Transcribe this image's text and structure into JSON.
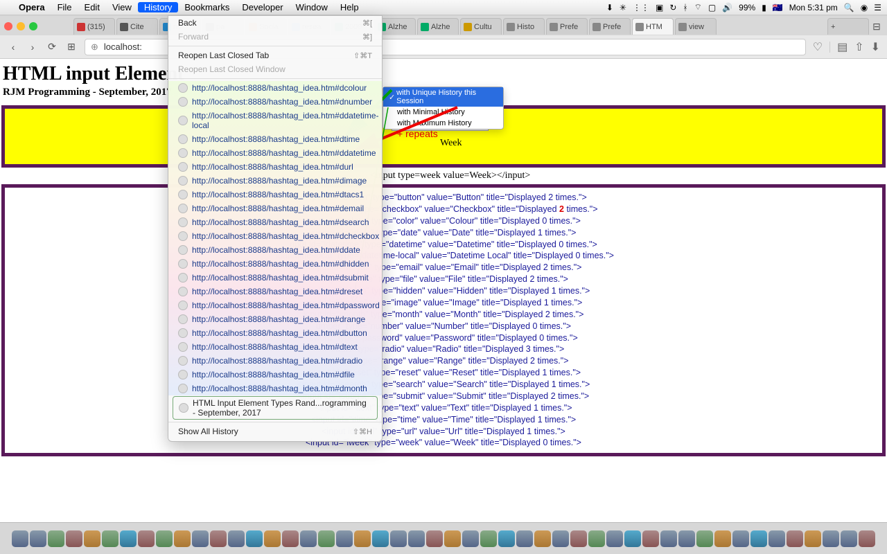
{
  "menubar": {
    "app": "Opera",
    "items": [
      "File",
      "Edit",
      "View",
      "History",
      "Bookmarks",
      "Developer",
      "Window",
      "Help"
    ],
    "open_index": 3,
    "tray": {
      "battery": "99%",
      "clock": "Mon 5:31 pm",
      "flag": "🇦🇺"
    }
  },
  "tabs": {
    "items": [
      {
        "label": "(315)",
        "icon": "#c33"
      },
      {
        "label": "Cite",
        "icon": "#555"
      },
      {
        "label": "ns",
        "icon": "#28c"
      },
      {
        "label": "pa",
        "icon": "#555"
      },
      {
        "label": "Socia",
        "icon": "#e60"
      },
      {
        "label": "resea",
        "icon": "#4285f4"
      },
      {
        "label": "2009",
        "icon": "#0a6"
      },
      {
        "label": "Alzhe",
        "icon": "#0a6"
      },
      {
        "label": "Alzhe",
        "icon": "#0a6"
      },
      {
        "label": "Cultu",
        "icon": "#c90"
      },
      {
        "label": "Histo",
        "icon": "#888"
      },
      {
        "label": "Prefe",
        "icon": "#888"
      },
      {
        "label": "Prefe",
        "icon": "#888"
      },
      {
        "label": "HTM",
        "icon": "#888",
        "active": true
      },
      {
        "label": "view",
        "icon": "#888"
      }
    ]
  },
  "address": "localhost:",
  "history_menu": {
    "back": "Back",
    "back_kb": "⌘[",
    "forward": "Forward",
    "forward_kb": "⌘]",
    "reopen": "Reopen Last Closed Tab",
    "reopen_kb": "⇧⌘T",
    "reopen_win": "Reopen Last Closed Window",
    "urls": [
      "http://localhost:8888/hashtag_idea.htm#dcolour",
      "http://localhost:8888/hashtag_idea.htm#dnumber",
      "http://localhost:8888/hashtag_idea.htm#ddatetime-local",
      "http://localhost:8888/hashtag_idea.htm#dtime",
      "http://localhost:8888/hashtag_idea.htm#ddatetime",
      "http://localhost:8888/hashtag_idea.htm#durl",
      "http://localhost:8888/hashtag_idea.htm#dimage",
      "http://localhost:8888/hashtag_idea.htm#dtacs1",
      "http://localhost:8888/hashtag_idea.htm#demail",
      "http://localhost:8888/hashtag_idea.htm#dsearch",
      "http://localhost:8888/hashtag_idea.htm#dcheckbox",
      "http://localhost:8888/hashtag_idea.htm#ddate",
      "http://localhost:8888/hashtag_idea.htm#dhidden",
      "http://localhost:8888/hashtag_idea.htm#dsubmit",
      "http://localhost:8888/hashtag_idea.htm#dreset",
      "http://localhost:8888/hashtag_idea.htm#dpassword",
      "http://localhost:8888/hashtag_idea.htm#drange",
      "http://localhost:8888/hashtag_idea.htm#dbutton",
      "http://localhost:8888/hashtag_idea.htm#dtext",
      "http://localhost:8888/hashtag_idea.htm#dradio",
      "http://localhost:8888/hashtag_idea.htm#dfile",
      "http://localhost:8888/hashtag_idea.htm#dmonth"
    ],
    "pagehist": "HTML Input Element Types Rand...rogramming - September, 2017",
    "showall": "Show All History",
    "showall_kb": "⇧⌘H"
  },
  "submenu": {
    "items": [
      "with Unique History this Session",
      "with Minimal History",
      "with Maximum History"
    ],
    "selected": 0
  },
  "page": {
    "h1": "HTML input Element",
    "h3": "RJM Programming - September, 2017",
    "week_placeholder": "Week --, ----",
    "week_label": "Week",
    "repeats": "+ repeats",
    "codeline": "<input type=week value=Week></input>",
    "codebox": [
      "<input id=\"ibutton\" type=\"button\" value=\"Button\" title=\"Displayed 2 times.\">",
      "ut id=\"icheckbox\" type=\"checkbox\" value=\"Checkbox\" title=\"Displayed 2 times.\">",
      "nput id=\"icolour\" type=\"color\" value=\"Colour\" title=\"Displayed 0 times.\">",
      "<input id=\"idate\" type=\"date\" value=\"Date\" title=\"Displayed 1 times.\">",
      "nput id=\"idatetime\" type=\"datetime\" value=\"Datetime\" title=\"Displayed 0 times.\">",
      "\"idatetime-local\" type=\"datetime-local\" value=\"Datetime Local\" title=\"Displayed 0 times.\">",
      "<input id=\"iemail\" type=\"email\" value=\"Email\" title=\"Displayed 2 times.\">",
      "<input id=\"ifile\" type=\"file\" value=\"File\" title=\"Displayed 2 times.\">",
      "<input id=\"ihidden\" type=\"hidden\" value=\"Hidden\" title=\"Displayed 1 times.\">",
      "nput id=\"iimage\" type=\"image\" value=\"Image\" title=\"Displayed 1 times.\">",
      "input id=\"imonth\" type=\"month\" value=\"Month\" title=\"Displayed 2 times.\">",
      "umber\" type=\"number\" value=\"Number\" title=\"Displayed 0 times.\">",
      "sword\" type=\"password\" value=\"Password\" title=\"Displayed 0 times.\">",
      "=\"iradio\" type=\"radio\" value=\"Radio\" title=\"Displayed 3 times.\">",
      "=\"irange\" type=\"range\" value=\"Range\" title=\"Displayed 2 times.\">",
      "<input id=\"ireset\" type=\"reset\" value=\"Reset\" title=\"Displayed 1 times.\">",
      "<input id=\"isearch\" type=\"search\" value=\"Search\" title=\"Displayed 1 times.\">",
      "<input id=\"isubmit\" type=\"submit\" value=\"Submit\" title=\"Displayed 2 times.\">",
      "<input id=\"itext\" type=\"text\" value=\"Text\" title=\"Displayed 1 times.\">",
      "<input id=\"itime\" type=\"time\" value=\"Time\" title=\"Displayed 1 times.\">",
      "<input id=\"iurl\" type=\"url\" value=\"Url\" title=\"Displayed 1 times.\">",
      "<input id=\"iweek\" type=\"week\" value=\"Week\" title=\"Displayed 0 times.\">"
    ]
  }
}
